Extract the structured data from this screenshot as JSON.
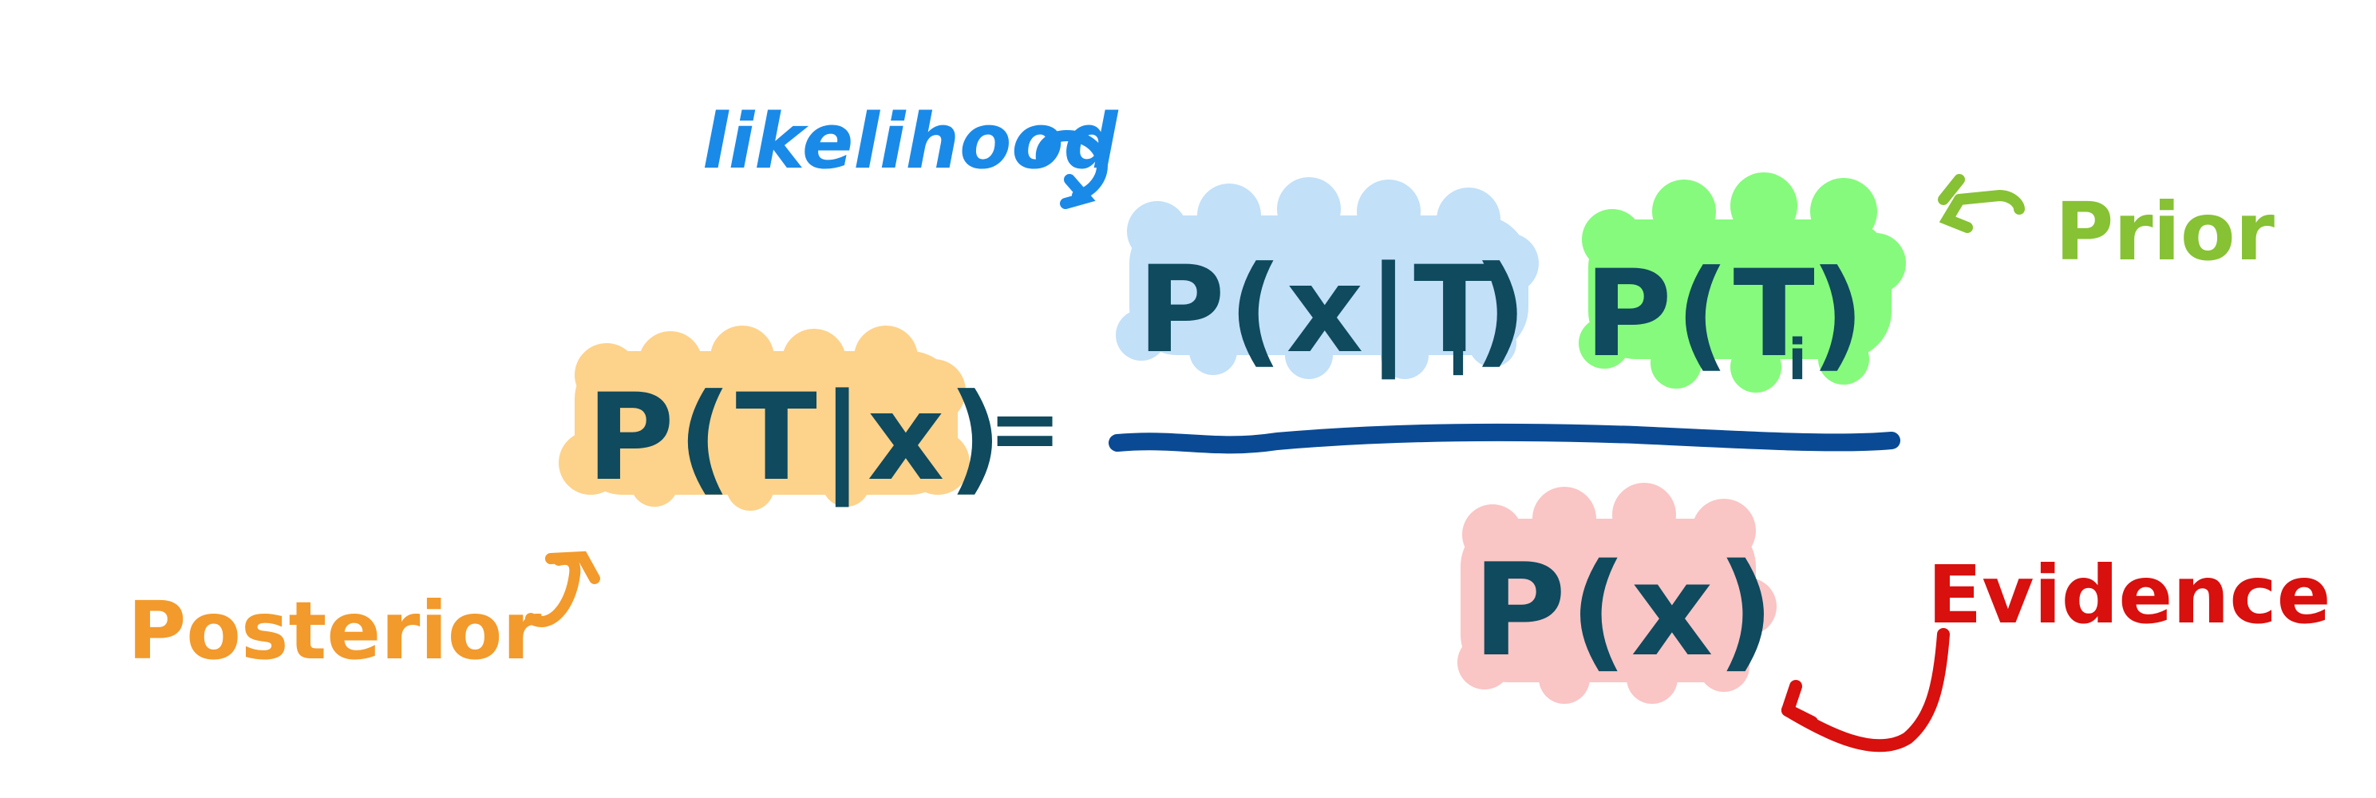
{
  "formula": {
    "posterior_expr": "P(T|x)",
    "equals": "=",
    "likelihood_expr": "P(x|T",
    "likelihood_subscript": "i",
    "likelihood_close": ")",
    "prior_expr": "P(T",
    "prior_subscript": "i",
    "prior_close": ")",
    "evidence_expr": "P(x)"
  },
  "annotations": {
    "likelihood": "likelihood",
    "prior": "Prior",
    "posterior": "Posterior",
    "evidence": "Evidence"
  },
  "colors": {
    "ink": "#0f4a5e",
    "fraction_bar": "#0a4a94",
    "posterior_highlight": "#fdd28b",
    "likelihood_highlight": "#c2e0f8",
    "prior_highlight": "#86fa7c",
    "evidence_highlight": "#fac5c5",
    "likelihood_label": "#1a8ae8",
    "prior_label": "#86c234",
    "posterior_label": "#f29a2c",
    "evidence_label": "#d8100e"
  }
}
